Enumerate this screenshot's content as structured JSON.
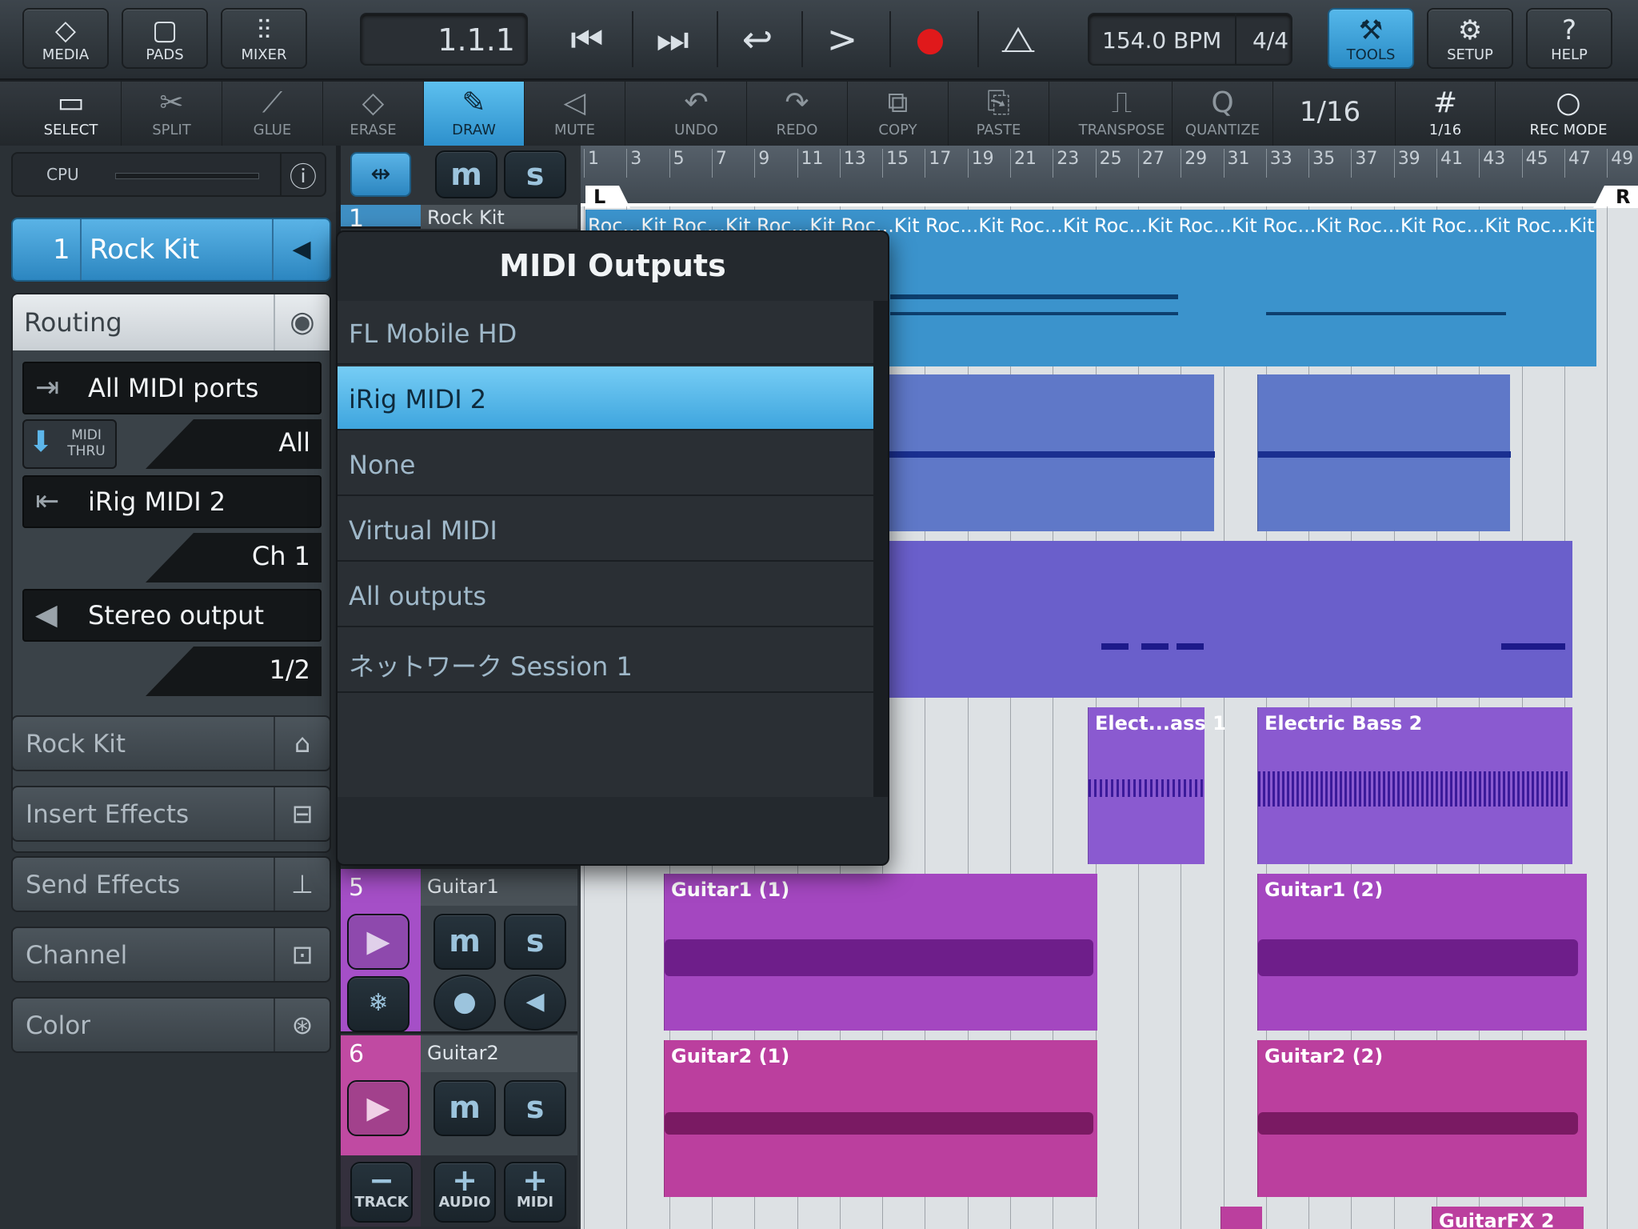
{
  "toolbar": {
    "media": "MEDIA",
    "pads": "PADS",
    "mixer": "MIXER",
    "position": "1.1.1",
    "tempo": "154.0 BPM",
    "signature": "4/4",
    "tools": "TOOLS",
    "setup": "SETUP",
    "help": "HELP"
  },
  "tools": {
    "select": "SELECT",
    "split": "SPLIT",
    "glue": "GLUE",
    "erase": "ERASE",
    "draw": "DRAW",
    "mute": "MUTE",
    "undo": "UNDO",
    "redo": "REDO",
    "copy": "COPY",
    "paste": "PASTE",
    "transpose": "TRANSPOSE",
    "quantize": "QUANTIZE",
    "quantize_value": "1/16",
    "grid": "1/16",
    "rec_mode": "REC MODE"
  },
  "left": {
    "cpu": "CPU",
    "track_number": "1",
    "track_name": "Rock Kit",
    "routing": "Routing",
    "input": "All MIDI ports",
    "midi_thru": "MIDI THRU",
    "input_channel": "All",
    "output": "iRig MIDI 2",
    "output_channel": "Ch 1",
    "audio_out": "Stereo output",
    "audio_channel": "1/2",
    "instrument": "Rock Kit",
    "insert": "Insert Effects",
    "send": "Send Effects",
    "channel": "Channel",
    "color": "Color"
  },
  "tracks": [
    {
      "num": "1",
      "name": "Rock Kit"
    },
    {
      "num": "5",
      "name": "Guitar1"
    },
    {
      "num": "6",
      "name": "Guitar2"
    }
  ],
  "add": {
    "track": "TRACK",
    "audio": "AUDIO",
    "midi": "MIDI"
  },
  "ruler": [
    "1",
    "3",
    "5",
    "7",
    "9",
    "11",
    "13",
    "15",
    "17",
    "19",
    "21",
    "23",
    "25",
    "27",
    "29",
    "31",
    "33",
    "35",
    "37",
    "39",
    "41",
    "43",
    "45",
    "47",
    "49"
  ],
  "locator": {
    "left": "L",
    "right": "R"
  },
  "clips": {
    "rock": "Roc...Kit",
    "bass1": "Elect...ass 1",
    "bass2": "Electric Bass 2",
    "g1a": "Guitar1 (1)",
    "g1b": "Guitar1 (2)",
    "g2a": "Guitar2 (1)",
    "g2b": "Guitar2 (2)",
    "fx": "GuitarFX 2"
  },
  "popup": {
    "title": "MIDI Outputs",
    "items": [
      "FL Mobile HD",
      "iRig MIDI 2",
      "None",
      "Virtual MIDI",
      "All outputs",
      "ネットワーク Session 1"
    ],
    "selected_index": 1
  },
  "colors": {
    "accent": "#3ea5de",
    "kit": "#3b93cc",
    "midi2": "#5f78c8",
    "midi3": "#6a5fcb",
    "bass": "#8a5ad0",
    "guitar1": "#a447c0",
    "guitar2": "#bb3f9e"
  }
}
